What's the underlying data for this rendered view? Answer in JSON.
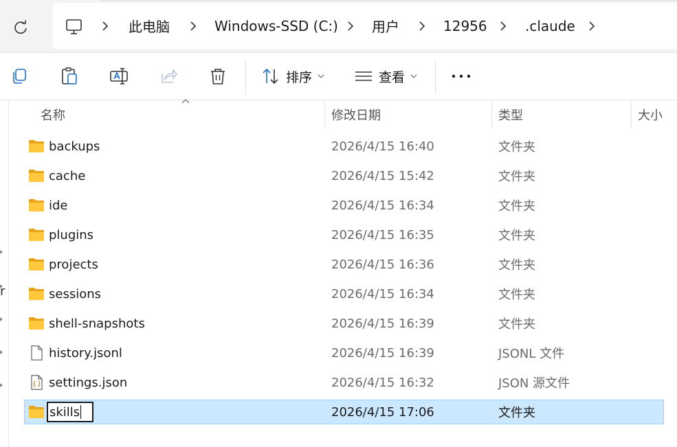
{
  "breadcrumb": {
    "items": [
      "此电脑",
      "Windows-SSD (C:)",
      "用户",
      "12956",
      ".claude"
    ]
  },
  "toolbar": {
    "sort_label": "排序",
    "view_label": "查看"
  },
  "columns": {
    "name": "名称",
    "date": "修改日期",
    "type": "类型",
    "size": "大小"
  },
  "left_fragment": "r",
  "files": [
    {
      "name": "backups",
      "date": "2026/4/15 16:40",
      "type": "文件夹",
      "icon": "folder-icon"
    },
    {
      "name": "cache",
      "date": "2026/4/15 15:42",
      "type": "文件夹",
      "icon": "folder-icon"
    },
    {
      "name": "ide",
      "date": "2026/4/15 16:34",
      "type": "文件夹",
      "icon": "folder-icon"
    },
    {
      "name": "plugins",
      "date": "2026/4/15 16:35",
      "type": "文件夹",
      "icon": "folder-icon"
    },
    {
      "name": "projects",
      "date": "2026/4/15 16:36",
      "type": "文件夹",
      "icon": "folder-icon"
    },
    {
      "name": "sessions",
      "date": "2026/4/15 16:34",
      "type": "文件夹",
      "icon": "folder-icon"
    },
    {
      "name": "shell-snapshots",
      "date": "2026/4/15 16:39",
      "type": "文件夹",
      "icon": "folder-icon"
    },
    {
      "name": "history.jsonl",
      "date": "2026/4/15 16:39",
      "type": "JSONL 文件",
      "icon": "file-icon"
    },
    {
      "name": "settings.json",
      "date": "2026/4/15 16:32",
      "type": "JSON 源文件",
      "icon": "json-file-icon"
    },
    {
      "name": "",
      "date": "2026/4/15 17:06",
      "type": "文件夹",
      "icon": "folder-icon"
    }
  ],
  "rename": {
    "value": "skills"
  },
  "colors": {
    "selection": "#cce8ff",
    "selection_border": "#99d1ff",
    "folder": "#ffc83d",
    "toolbar_bg": "#f3f3f3"
  }
}
